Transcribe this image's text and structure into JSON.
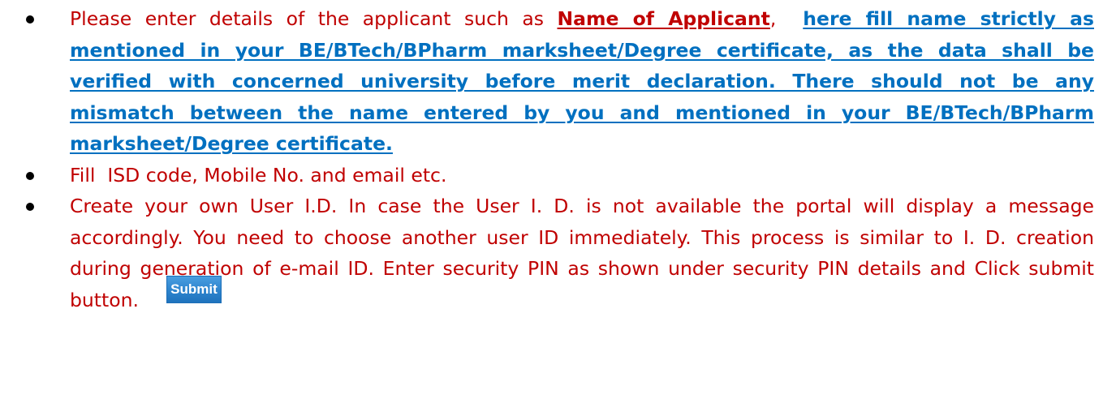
{
  "instructions": {
    "item1": {
      "lead_text": "Please enter details of the applicant such as ",
      "field_name": "Name of Applicant",
      "separator": ",  ",
      "note": "here fill name strictly as mentioned in your BE/BTech/BPharm marksheet/Degree certificate, as the data shall be verified with concerned university before merit declaration. There should not be any mismatch between the name entered by you and mentioned in your BE/BTech/BPharm marksheet/Degree certificate."
    },
    "item2": {
      "text": "Fill  ISD code, Mobile No. and email etc."
    },
    "item3": {
      "text": "Create your own User I.D. In case the User I. D. is not available the portal will display a message accordingly. You need to choose another user ID immediately. This process is similar to I. D. creation during generation of e-mail ID. Enter security PIN as shown under security PIN details and Click submit button."
    }
  },
  "submit_button": {
    "label": "Submit"
  },
  "colors": {
    "body_text": "#c00000",
    "highlight_blue": "#0070c0",
    "button_blue": "#2f86cf",
    "bullet": "#000000"
  }
}
